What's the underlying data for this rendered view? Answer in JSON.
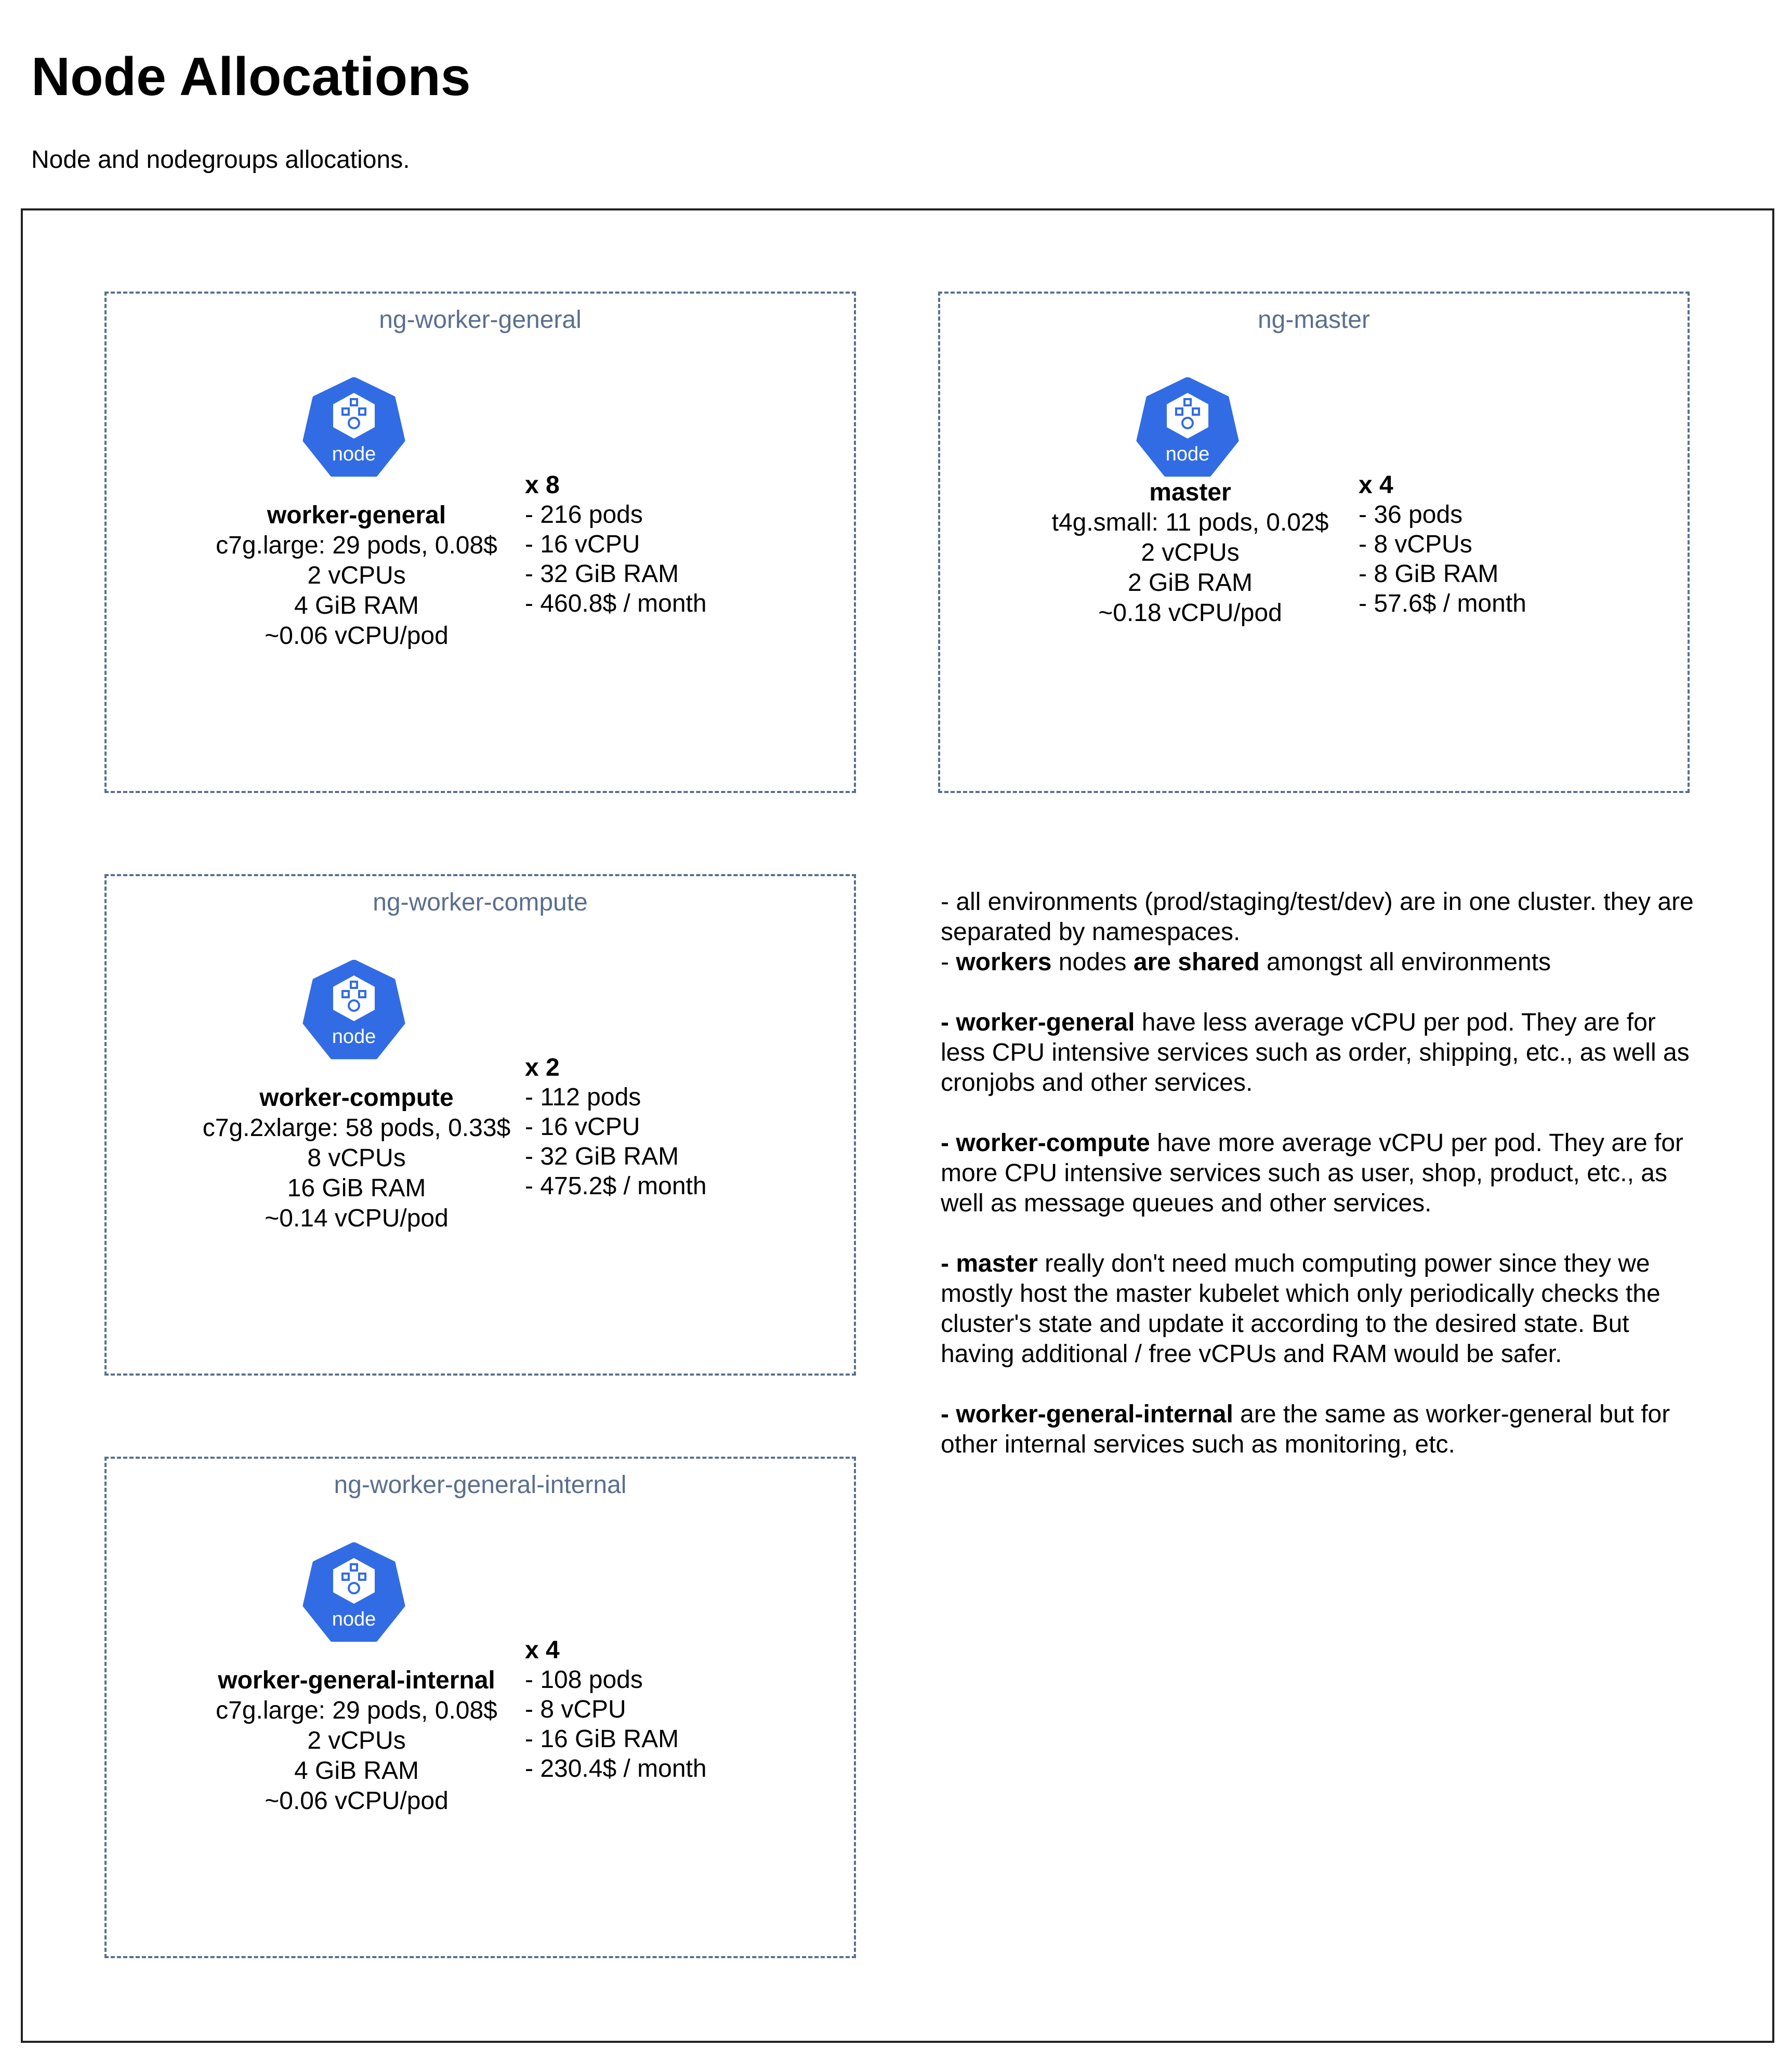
{
  "page": {
    "title": "Node Allocations",
    "subtitle": "Node and nodegroups allocations."
  },
  "icon": {
    "name": "kubernetes-node-icon",
    "label": "node",
    "color": "#326ce5"
  },
  "colors": {
    "group_border": "#5a6f8e",
    "group_label": "#5a6f8e",
    "frame_border": "#222222"
  },
  "nodegroups": {
    "worker_general": {
      "label": "ng-worker-general",
      "node_name": "worker-general",
      "instance": "c7g.large: 29 pods, 0.08$",
      "vcpus": "2 vCPUs",
      "ram": "4 GiB RAM",
      "vcpu_per_pod": "~0.06 vCPU/pod",
      "count": "x 8",
      "pods": "- 216 pods",
      "total_vcpu": "- 16 vCPU",
      "total_ram": "- 32 GiB RAM",
      "cost": "- 460.8$ / month"
    },
    "master": {
      "label": "ng-master",
      "node_name": "master",
      "instance": "t4g.small: 11 pods, 0.02$",
      "vcpus": "2 vCPUs",
      "ram": "2 GiB RAM",
      "vcpu_per_pod": "~0.18 vCPU/pod",
      "count": "x 4",
      "pods": "- 36 pods",
      "total_vcpu": "- 8 vCPUs",
      "total_ram": "- 8 GiB RAM",
      "cost": "- 57.6$ / month"
    },
    "worker_compute": {
      "label": "ng-worker-compute",
      "node_name": "worker-compute",
      "instance": "c7g.2xlarge: 58 pods, 0.33$",
      "vcpus": "8 vCPUs",
      "ram": "16 GiB RAM",
      "vcpu_per_pod": "~0.14 vCPU/pod",
      "count": "x 2",
      "pods": "- 112 pods",
      "total_vcpu": "- 16 vCPU",
      "total_ram": "- 32 GiB RAM",
      "cost": "- 475.2$ / month"
    },
    "worker_general_internal": {
      "label": "ng-worker-general-internal",
      "node_name": "worker-general-internal",
      "instance": "c7g.large: 29 pods, 0.08$",
      "vcpus": "2 vCPUs",
      "ram": "4 GiB RAM",
      "vcpu_per_pod": "~0.06 vCPU/pod",
      "count": "x 4",
      "pods": "- 108 pods",
      "total_vcpu": "- 8 vCPU",
      "total_ram": "- 16 GiB RAM",
      "cost": "- 230.4$ / month"
    }
  },
  "notes": {
    "p1": {
      "a": "- all environments (prod/staging/test/dev) are in one cluster. they are separated by namespaces.",
      "b": "- ",
      "c": "workers",
      "d": " nodes ",
      "e": "are shared",
      "f": " amongst all environments"
    },
    "p2": {
      "term": "- worker-general",
      "text": " have less average vCPU per pod. They are for less CPU intensive services such as order, shipping, etc., as well as cronjobs and other services."
    },
    "p3": {
      "term": "- worker-compute",
      "text": " have more average vCPU per pod. They are for more CPU intensive services such as user, shop, product, etc., as well as message queues and other services."
    },
    "p4": {
      "term": "- master",
      "text": " really don't need much computing power since they we mostly host the master kubelet which only periodically checks the cluster's state and update it according to the desired state. But having additional / free vCPUs and RAM would be safer."
    },
    "p5": {
      "term": "- worker-general-internal",
      "text": " are the same as worker-general but for other internal services such as monitoring, etc."
    }
  }
}
